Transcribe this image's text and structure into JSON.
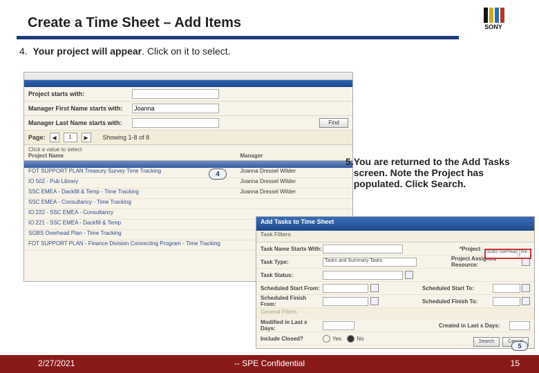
{
  "title": "Create a Time Sheet – Add Items",
  "logo_text": "SONY",
  "step4": {
    "number": "4.",
    "line1_bold1": "Your project will appear",
    "line1_plain1": ". ",
    "line1_plain2": "Click on it to select."
  },
  "step5": {
    "number": "5.",
    "text": "You are returned to the Add Tasks screen. Note the Project has populated. Click Search."
  },
  "footer": {
    "date": "2/27/2021",
    "confidential": "-- SPE Confidential",
    "page": "15"
  },
  "screenshot1": {
    "filters": {
      "project_starts": {
        "label": "Project starts with:",
        "value": ""
      },
      "mgr_first": {
        "label": "Manager First Name starts with:",
        "value": "Joanna"
      },
      "mgr_last": {
        "label": "Manager Last Name starts with:",
        "value": ""
      }
    },
    "find_btn": "Find",
    "pager": {
      "label": "Page:",
      "page": "1",
      "showing": "Showing 1-8 of 8"
    },
    "head": {
      "c1a": "Click a value to select",
      "c1b": "Project Name",
      "c2": "Manager"
    },
    "rows": [
      {
        "proj": "FOT SUPPORT PLAN Treasury Survey Time Tracking",
        "mgr": "Joanna Dressel Wilder"
      },
      {
        "proj": "IO 502 - Pub Library",
        "mgr": "Joanna Dressel Wilder"
      },
      {
        "proj": "SSC EMEA - Dackfill & Temp - Time Tracking",
        "mgr": "Joanna Dressel Wilder"
      },
      {
        "proj": "SSC EMEA - Consultancy - Time Tracking",
        "mgr": ""
      },
      {
        "proj": "IO 222 - SSC EMEA - Consultancy",
        "mgr": ""
      },
      {
        "proj": "IO 221 - SSC EMEA - Dackfill & Temp",
        "mgr": ""
      },
      {
        "proj": "SGBS Overhead Plan - Time Tracking",
        "mgr": ""
      },
      {
        "proj": "FOT SUPPORT PLAN - Finance Division Connecting Program - Time Tracking",
        "mgr": ""
      }
    ]
  },
  "badge4": "4",
  "badge5": "5",
  "screenshot2": {
    "title": "Add Tasks to Time Sheet",
    "tab": "Task Filters",
    "fields": {
      "task_name": {
        "label": "Task Name Starts With:",
        "value": ""
      },
      "task_type": {
        "label": "Task Type:",
        "select": "Tasks and Summary Tasks"
      },
      "task_status": {
        "label": "Task Status:",
        "value": ""
      },
      "sched_start_from": {
        "label": "Scheduled Start From:",
        "to_label": "Scheduled Start To:"
      },
      "sched_finish_from": {
        "label": "Scheduled Finish From:",
        "to_label": "Scheduled Finish To:"
      },
      "general": "General Filters",
      "modified": {
        "label": "Modified in Last x Days:",
        "right": "Created in Last x Days:"
      },
      "include_closed": {
        "label": "Include Closed?",
        "yes": "Yes",
        "no": "No"
      },
      "project_label": "*Project",
      "project_value": "SGBS Overhead Plan",
      "project_tag": "Time T",
      "assigned_label": "Project Assigned Resource:"
    },
    "buttons": {
      "search": "Search",
      "cancel": "Cancel"
    }
  }
}
